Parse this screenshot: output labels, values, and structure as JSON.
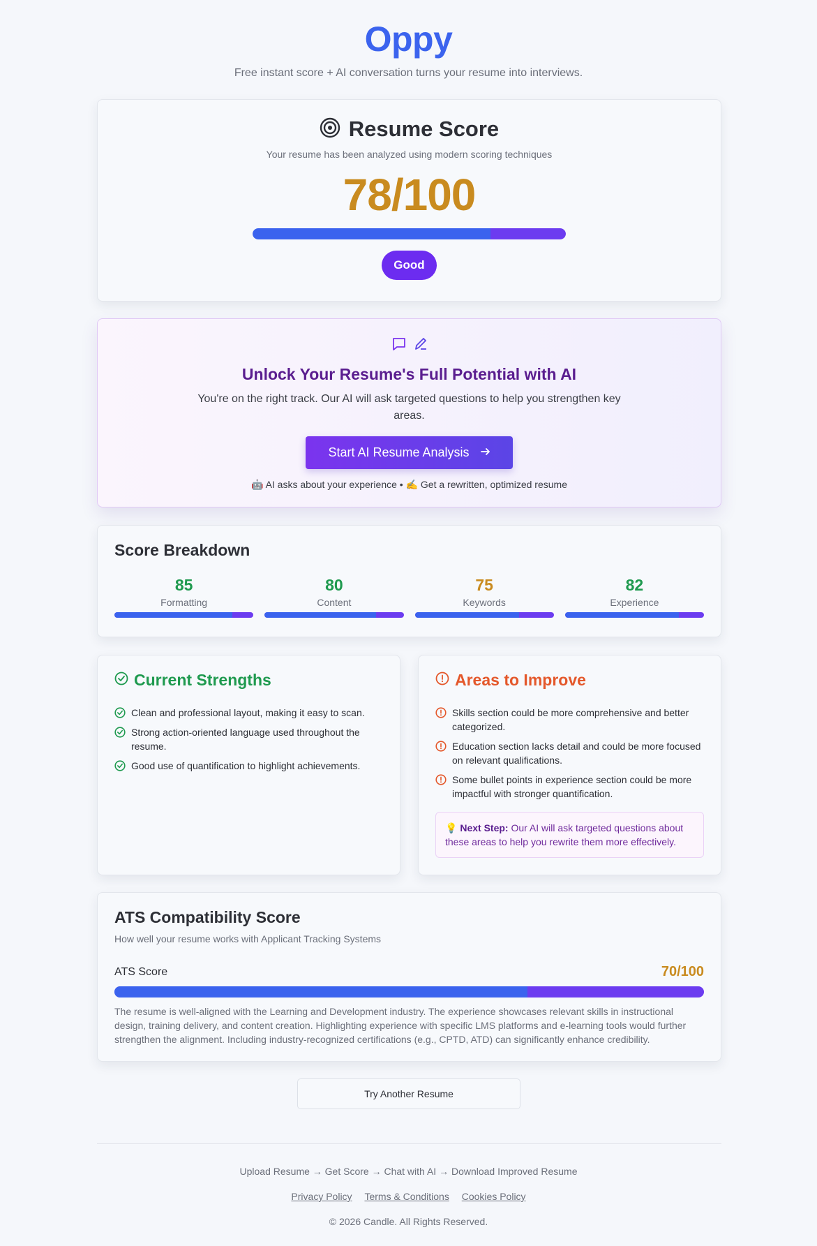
{
  "header": {
    "brand": "Oppy",
    "tagline": "Free instant score + AI conversation turns your resume into interviews."
  },
  "score": {
    "title": "Resume Score",
    "subtitle": "Your resume has been analyzed using modern scoring techniques",
    "value": "78/100",
    "progress": 0.78,
    "badge": "Good",
    "colors": {
      "score": "#c98b1f",
      "bar_primary": "#3b63ee",
      "bar_secondary": "#6c3cf0",
      "badge": "#6c2cf0"
    }
  },
  "ai": {
    "title": "Unlock Your Resume's Full Potential with AI",
    "description": "You're on the right track. Our AI will ask targeted questions to help you strengthen key areas.",
    "button": "Start AI Resume Analysis",
    "footnote": "🤖 AI asks about your experience • ✍️ Get a rewritten, optimized resume",
    "icons": [
      "chat-icon",
      "pencil-icon",
      "arrow-right-icon"
    ]
  },
  "breakdown": {
    "title": "Score Breakdown",
    "items": [
      {
        "value": "85",
        "label": "Formatting",
        "fraction": 0.85,
        "color": "#1f9a4f"
      },
      {
        "value": "80",
        "label": "Content",
        "fraction": 0.8,
        "color": "#1f9a4f"
      },
      {
        "value": "75",
        "label": "Keywords",
        "fraction": 0.75,
        "color": "#c98b1f"
      },
      {
        "value": "82",
        "label": "Experience",
        "fraction": 0.82,
        "color": "#1f9a4f"
      }
    ]
  },
  "strengths": {
    "title": "Current Strengths",
    "color": "#1f9a4f",
    "items": [
      "Clean and professional layout, making it easy to scan.",
      "Strong action-oriented language used throughout the resume.",
      "Good use of quantification to highlight achievements."
    ]
  },
  "improve": {
    "title": "Areas to Improve",
    "color": "#e4582b",
    "items": [
      "Skills section could be more comprehensive and better categorized.",
      "Education section lacks detail and could be more focused on relevant qualifications.",
      "Some bullet points in experience section could be more impactful with stronger quantification."
    ],
    "next_step_label": "Next Step:",
    "next_step_text": "Our AI will ask targeted questions about these areas to help you rewrite them more effectively.",
    "next_step_icon": "💡"
  },
  "ats": {
    "title": "ATS Compatibility Score",
    "subtitle": "How well your resume works with Applicant Tracking Systems",
    "label": "ATS Score",
    "value": "70/100",
    "fraction": 0.7,
    "description": "The resume is well-aligned with the Learning and Development industry. The experience showcases relevant skills in instructional design, training delivery, and content creation. Highlighting experience with specific LMS platforms and e-learning tools would further strengthen the alignment. Including industry-recognized certifications (e.g., CPTD, ATD) can significantly enhance credibility."
  },
  "actions": {
    "try_another": "Try Another Resume"
  },
  "footer": {
    "flow": "Upload Resume → Get Score → Chat with AI → Download Improved Resume",
    "links": [
      "Privacy Policy",
      "Terms & Conditions",
      "Cookies Policy"
    ],
    "copyright": "© 2026 Candle. All Rights Reserved."
  }
}
